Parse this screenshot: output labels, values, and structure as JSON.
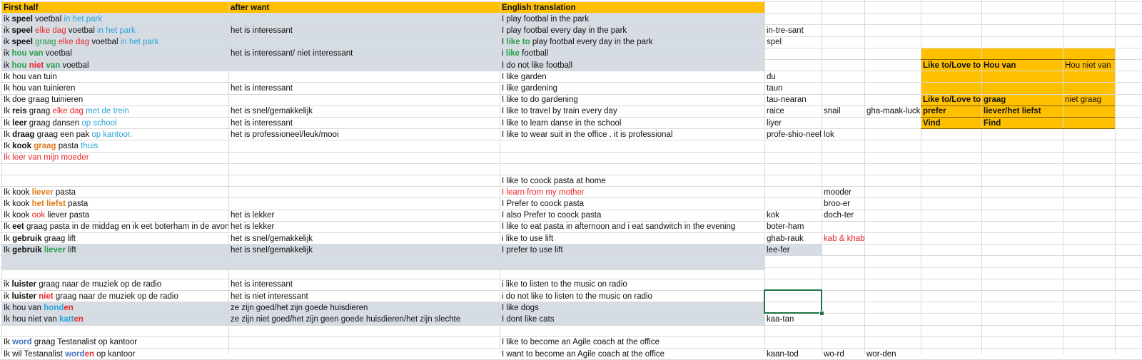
{
  "colors": {
    "header_fill": "#ffc000",
    "band_fill": "#d6dce4",
    "grid_line": "#d9d9d9",
    "selection": "#217346",
    "blue": "#2aa3d6",
    "red": "#e8262a",
    "green": "#27a048",
    "orange": "#e07a16"
  },
  "selected_cell": "D25",
  "rows": [
    {
      "a": [
        {
          "t": "First half",
          "c": "b"
        }
      ],
      "b": [
        {
          "t": "after want",
          "c": "b"
        }
      ],
      "c": [
        {
          "t": "English translation",
          "c": "b"
        }
      ]
    },
    {
      "a": [
        {
          "t": "ik "
        },
        {
          "t": "speel",
          "c": "b"
        },
        {
          "t": " voetbal "
        },
        {
          "t": "in het park",
          "c": "blue"
        }
      ],
      "c": [
        {
          "t": "I play footbal in the park"
        }
      ]
    },
    {
      "a": [
        {
          "t": "ik "
        },
        {
          "t": "speel",
          "c": "b"
        },
        {
          "t": " "
        },
        {
          "t": "elke dag",
          "c": "red"
        },
        {
          "t": " voetbal "
        },
        {
          "t": "in het park",
          "c": "blue"
        }
      ],
      "b": [
        {
          "t": "het is interessant"
        }
      ],
      "c": [
        {
          "t": "I play footbal every day in the park"
        }
      ],
      "d": [
        {
          "t": "in-tre-sant"
        }
      ]
    },
    {
      "a": [
        {
          "t": "ik "
        },
        {
          "t": "speel",
          "c": "b"
        },
        {
          "t": " "
        },
        {
          "t": "graag",
          "c": "green"
        },
        {
          "t": " "
        },
        {
          "t": "elke dag",
          "c": "red"
        },
        {
          "t": " voetbal "
        },
        {
          "t": "in het park",
          "c": "blue"
        }
      ],
      "c": [
        {
          "t": "I "
        },
        {
          "t": "like to",
          "c": "green b"
        },
        {
          "t": " play footbal every day in the park"
        }
      ],
      "d": [
        {
          "t": "spel"
        }
      ]
    },
    {
      "a": [
        {
          "t": "ik "
        },
        {
          "t": "hou van",
          "c": "green b"
        },
        {
          "t": " voetbal"
        }
      ],
      "b": [
        {
          "t": "het is interessant/ niet interessant"
        }
      ],
      "c": [
        {
          "t": "i "
        },
        {
          "t": "like",
          "c": "green b"
        },
        {
          "t": " football"
        }
      ]
    },
    {
      "a": [
        {
          "t": "ik "
        },
        {
          "t": "hou",
          "c": "green b"
        },
        {
          "t": " "
        },
        {
          "t": "niet",
          "c": "red b"
        },
        {
          "t": " "
        },
        {
          "t": "van",
          "c": "green b"
        },
        {
          "t": " voetbal"
        }
      ],
      "c": [
        {
          "t": "I do not like football"
        }
      ],
      "f": [
        {
          "t": "Like to/Love to",
          "c": "b"
        }
      ],
      "g": [
        {
          "t": "Hou van",
          "c": "b"
        }
      ],
      "h": [
        {
          "t": "Hou niet van"
        }
      ]
    },
    {
      "a": [
        {
          "t": "Ik hou van tuin"
        }
      ],
      "c": [
        {
          "t": "I like garden"
        }
      ],
      "d": [
        {
          "t": "du"
        }
      ]
    },
    {
      "a": [
        {
          "t": "Ik hou van tuinieren"
        }
      ],
      "b": [
        {
          "t": "het is interessant"
        }
      ],
      "c": [
        {
          "t": "I like gardening"
        }
      ],
      "d": [
        {
          "t": "taun"
        }
      ]
    },
    {
      "a": [
        {
          "t": "Ik doe graag tuinieren"
        }
      ],
      "c": [
        {
          "t": "I like to do gardening"
        }
      ],
      "d": [
        {
          "t": "tau-nearan"
        }
      ],
      "f": [
        {
          "t": "Like to/Love to",
          "c": "b"
        }
      ],
      "g": [
        {
          "t": "graag",
          "c": "b"
        }
      ],
      "h": [
        {
          "t": "niet graag"
        }
      ]
    },
    {
      "a": [
        {
          "t": "Ik "
        },
        {
          "t": "reis",
          "c": "b"
        },
        {
          "t": " graag "
        },
        {
          "t": "elke dag",
          "c": "red"
        },
        {
          "t": " "
        },
        {
          "t": "met de trein",
          "c": "blue"
        }
      ],
      "b": [
        {
          "t": "het is snel/gemakkelijk"
        }
      ],
      "c": [
        {
          "t": "I like to travel by train every day"
        }
      ],
      "d": [
        {
          "t": "raice"
        }
      ],
      "e": [
        {
          "t": "snail"
        }
      ],
      "e2": [
        {
          "t": "gha-maak-luck"
        }
      ],
      "f": [
        {
          "t": "prefer",
          "c": "b"
        }
      ],
      "g": [
        {
          "t": "liever/het liefst",
          "c": "b"
        }
      ]
    },
    {
      "a": [
        {
          "t": "Ik "
        },
        {
          "t": "leer",
          "c": "b"
        },
        {
          "t": " graag dansen "
        },
        {
          "t": "op school",
          "c": "blue"
        }
      ],
      "b": [
        {
          "t": "het is interessant"
        }
      ],
      "c": [
        {
          "t": "I like to learn danse in the school"
        }
      ],
      "d": [
        {
          "t": "liyer"
        }
      ],
      "f": [
        {
          "t": "Vind",
          "c": "b"
        }
      ],
      "g": [
        {
          "t": "Find",
          "c": "b"
        }
      ]
    },
    {
      "a": [
        {
          "t": "Ik "
        },
        {
          "t": "draag",
          "c": "b"
        },
        {
          "t": " graag een pak "
        },
        {
          "t": "op kantoor.",
          "c": "blue"
        }
      ],
      "b": [
        {
          "t": "het is professioneel/leuk/mooi"
        }
      ],
      "c": [
        {
          "t": "I like to wear suit in the office . it is professional"
        }
      ],
      "d": [
        {
          "t": "profe-shio-neel"
        }
      ],
      "e": [
        {
          "t": "lok"
        }
      ]
    },
    {
      "a": [
        {
          "t": "Ik "
        },
        {
          "t": "kook",
          "c": "b"
        },
        {
          "t": " "
        },
        {
          "t": "graag",
          "c": "orange b"
        },
        {
          "t": " pasta "
        },
        {
          "t": "thuis",
          "c": "blue"
        }
      ]
    },
    {
      "a": [
        {
          "t": "Ik leer van mijn moeder",
          "c": "red"
        }
      ]
    },
    {},
    {
      "c": [
        {
          "t": "I like to coock pasta at home"
        }
      ]
    },
    {
      "a": [
        {
          "t": "Ik kook "
        },
        {
          "t": "liever",
          "c": "orange b"
        },
        {
          "t": " pasta"
        }
      ],
      "c": [
        {
          "t": "I learn from my mother",
          "c": "red"
        }
      ],
      "e": [
        {
          "t": "mooder"
        }
      ]
    },
    {
      "a": [
        {
          "t": "Ik kook "
        },
        {
          "t": "het liefst",
          "c": "orange b"
        },
        {
          "t": " pasta"
        }
      ],
      "c": [
        {
          "t": "I Prefer to coock pasta"
        }
      ],
      "e": [
        {
          "t": "broo-er"
        }
      ]
    },
    {
      "a": [
        {
          "t": "Ik kook "
        },
        {
          "t": "ook",
          "c": "red"
        },
        {
          "t": " liever pasta"
        }
      ],
      "b": [
        {
          "t": "het is lekker"
        }
      ],
      "c": [
        {
          "t": "I also Prefer to coock pasta"
        }
      ],
      "d": [
        {
          "t": "kok"
        }
      ],
      "e": [
        {
          "t": "doch-ter"
        }
      ]
    },
    {
      "a": [
        {
          "t": "Ik "
        },
        {
          "t": "eet",
          "c": "b"
        },
        {
          "t": " graag pasta in de middag en ik eet boterham in de avond"
        }
      ],
      "b": [
        {
          "t": "het is lekker"
        }
      ],
      "c": [
        {
          "t": "I like to eat pasta in afternoon and i eat sandwitch in the evening"
        }
      ],
      "d": [
        {
          "t": "boter-ham"
        }
      ]
    },
    {
      "a": [
        {
          "t": "Ik "
        },
        {
          "t": "gebruik",
          "c": "b"
        },
        {
          "t": " graag lift"
        }
      ],
      "b": [
        {
          "t": "het is snel/gemakkelijk"
        }
      ],
      "c": [
        {
          "t": "i like to use lift"
        }
      ],
      "d": [
        {
          "t": "ghab-rauk"
        }
      ],
      "e": [
        {
          "t": "kab & khab",
          "c": "red"
        }
      ]
    },
    {
      "a": [
        {
          "t": "Ik "
        },
        {
          "t": "gebruik",
          "c": "b"
        },
        {
          "t": " "
        },
        {
          "t": "liever",
          "c": "green b"
        },
        {
          "t": " lift"
        }
      ],
      "b": [
        {
          "t": "het is snel/gemakkelijk"
        }
      ],
      "c": [
        {
          "t": "I prefer to use lift"
        }
      ],
      "d": [
        {
          "t": "lee-fer"
        }
      ]
    },
    {},
    {},
    {
      "a": [
        {
          "t": "ik "
        },
        {
          "t": "luister",
          "c": "b"
        },
        {
          "t": " graag naar de muziek op de radio"
        }
      ],
      "b": [
        {
          "t": "het is interessant"
        }
      ],
      "c": [
        {
          "t": "i like to listen to the music on radio"
        }
      ]
    },
    {
      "a": [
        {
          "t": "ik "
        },
        {
          "t": "luister",
          "c": "b"
        },
        {
          "t": " "
        },
        {
          "t": "niet",
          "c": "red b"
        },
        {
          "t": " graag naar de muziek op de radio"
        }
      ],
      "b": [
        {
          "t": "het is niet interessant"
        }
      ],
      "c": [
        {
          "t": "i do not like to listen to the music on radio"
        }
      ]
    },
    {
      "a": [
        {
          "t": "Ik hou van "
        },
        {
          "t": "hond",
          "c": "blue b"
        },
        {
          "t": "en",
          "c": "red b"
        }
      ],
      "b": [
        {
          "t": "ze zijn goed/het zijn goede huisdieren"
        }
      ],
      "c": [
        {
          "t": "I like dogs"
        }
      ]
    },
    {
      "a": [
        {
          "t": "Ik hou niet van "
        },
        {
          "t": "katt",
          "c": "blue b"
        },
        {
          "t": "en",
          "c": "red b"
        }
      ],
      "b": [
        {
          "t": "ze zijn niet goed/het zijn geen goede huisdieren/het zijn slechte"
        }
      ],
      "c": [
        {
          "t": "I dont like cats"
        }
      ],
      "d": [
        {
          "t": "kaa-tan"
        }
      ]
    },
    {},
    {
      "a": [
        {
          "t": "Ik "
        },
        {
          "t": "word",
          "c": "darkblue b"
        },
        {
          "t": " graag Testanalist op kantoor"
        }
      ],
      "c": [
        {
          "t": "I like to become an Agile coach at the office"
        }
      ]
    },
    {
      "a": [
        {
          "t": "Ik wil Testanalist "
        },
        {
          "t": "word",
          "c": "darkblue b"
        },
        {
          "t": "en",
          "c": "red b"
        },
        {
          "t": " op kantoor"
        }
      ],
      "c": [
        {
          "t": "I want to become an Agile coach at the office"
        }
      ],
      "d": [
        {
          "t": "kaan-tod"
        }
      ],
      "e": [
        {
          "t": "wo-rd"
        }
      ],
      "e2": [
        {
          "t": "wor-den"
        }
      ]
    }
  ]
}
